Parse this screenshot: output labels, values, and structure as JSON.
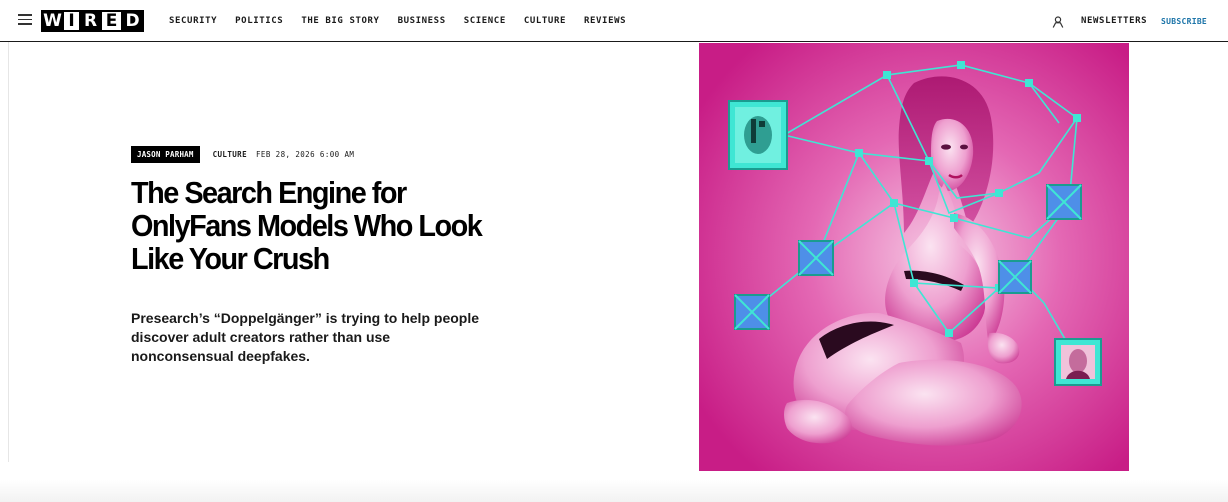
{
  "header": {
    "logo_letters": [
      "W",
      "I",
      "R",
      "E",
      "D"
    ],
    "nav_items": [
      {
        "label": "SECURITY"
      },
      {
        "label": "POLITICS"
      },
      {
        "label": "THE BIG STORY"
      },
      {
        "label": "BUSINESS"
      },
      {
        "label": "SCIENCE"
      },
      {
        "label": "CULTURE"
      },
      {
        "label": "REVIEWS"
      }
    ],
    "newsletters_label": "NEWSLETTERS",
    "subscribe_label": "SUBSCRIBE",
    "icons": [
      "hamburger-menu-icon",
      "account-icon"
    ]
  },
  "article": {
    "author": "JASON PARHAM",
    "rubric": "CULTURE",
    "date": "FEB 28, 2026 6:00 AM",
    "title": "The Search Engine for OnlyFans Models Who Look Like Your Crush",
    "dek": "Presearch’s “Doppelgänger” is trying to help people discover adult creators rather than use nonconsensual deepfakes."
  },
  "colors": {
    "text": "#000000",
    "subscribe": "#1a73a8",
    "image_pink": "#e03a9e",
    "image_cyan": "#3fe6d4"
  }
}
